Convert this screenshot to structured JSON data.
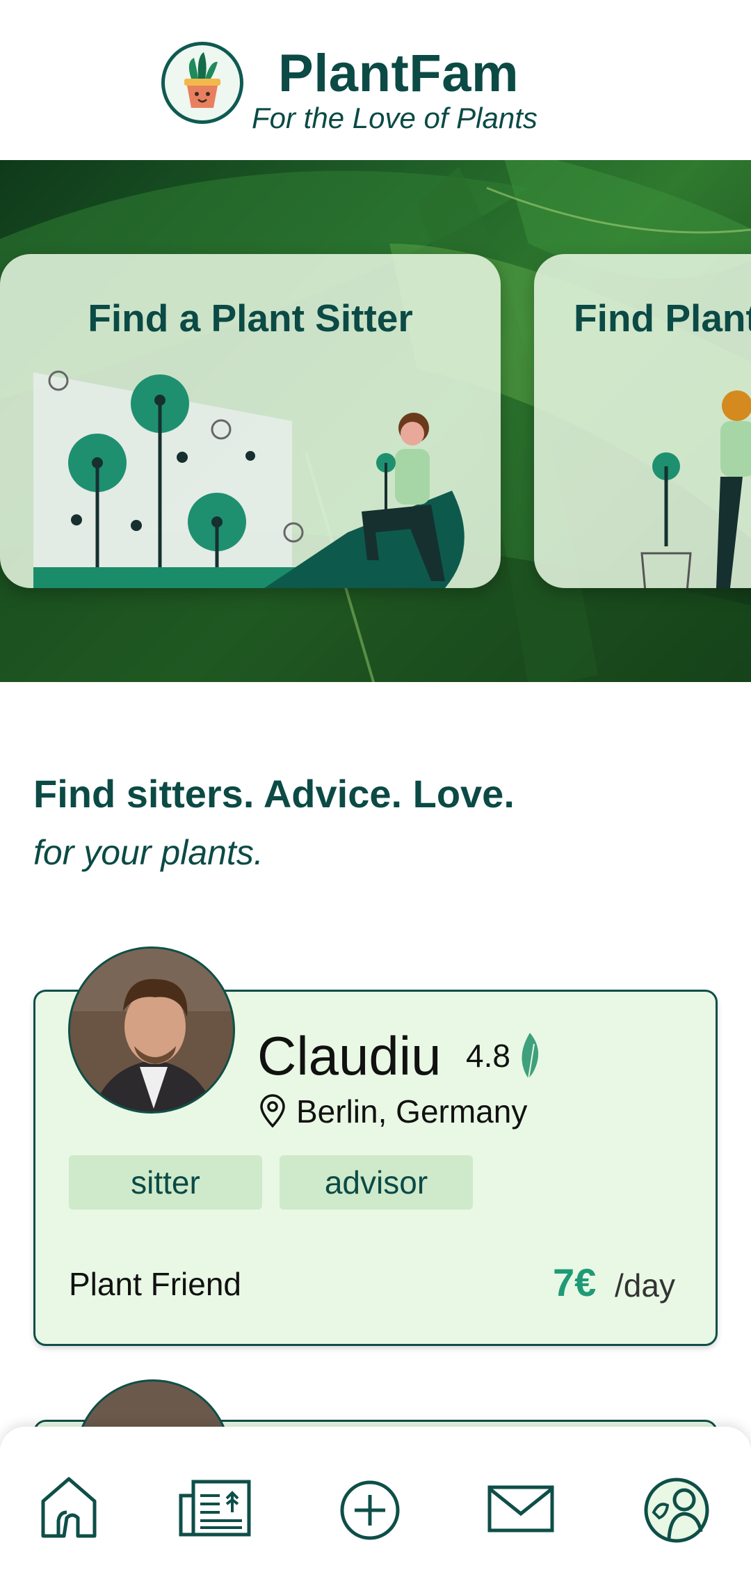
{
  "app": {
    "title": "PlantFam",
    "subtitle": "For the Love of Plants"
  },
  "hero_cards": [
    {
      "title": "Find a Plant Sitter"
    },
    {
      "title": "Find Plant"
    }
  ],
  "tagline": {
    "main": "Find sitters. Advice. Love.",
    "sub": "for your plants."
  },
  "sitter": {
    "name": "Claudiu",
    "rating": "4.8",
    "location": "Berlin, Germany",
    "tags": [
      "sitter",
      "advisor"
    ],
    "role": "Plant Friend",
    "price": "7€",
    "price_unit": "/day"
  },
  "nav": {
    "items": [
      "home-icon",
      "news-icon",
      "add-icon",
      "messages-icon",
      "profile-icon"
    ]
  },
  "colors": {
    "primary": "#0b4a45",
    "accent": "#1f9a76",
    "card_bg": "#e8f8e4",
    "tag_bg": "#cfe9cb"
  }
}
